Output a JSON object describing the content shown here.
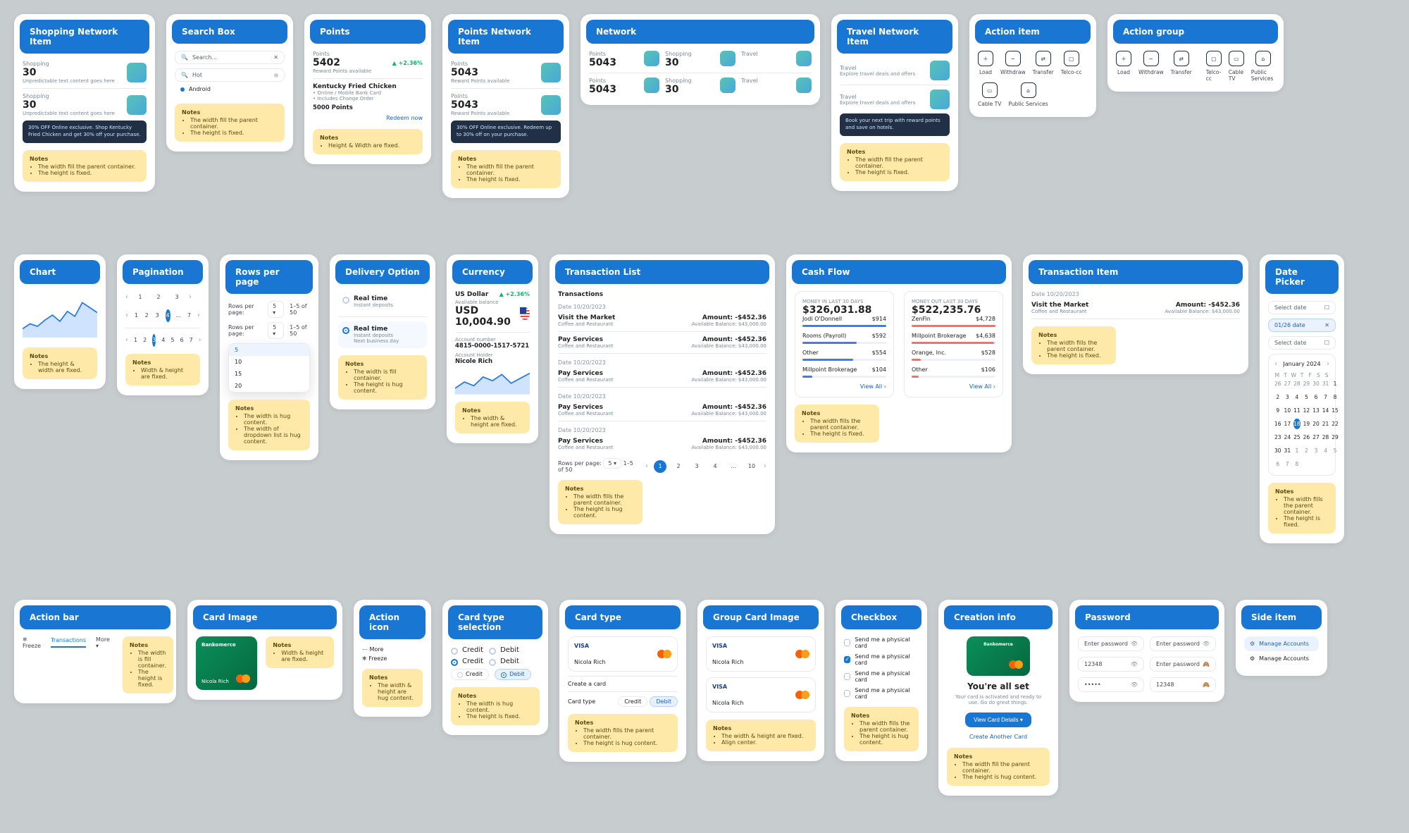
{
  "row1": {
    "shopping_item": {
      "title": "Shopping Network Item",
      "items": [
        {
          "label": "Shopping",
          "value": "30",
          "sub": "Unpredictable text content goes here"
        },
        {
          "label": "Shopping",
          "value": "30",
          "sub": "Unpredictable text content goes here"
        }
      ],
      "footer": "30% OFF Online exclusive. Shop Kentucky Fried Chicken and get 30% off your purchase.",
      "notes": {
        "title": "Notes",
        "items": [
          "The width fill the parent container.",
          "The height is fixed."
        ]
      }
    },
    "search_box": {
      "title": "Search Box",
      "placeholder": "Search...",
      "hot": "Hot",
      "android": "Android",
      "notes": {
        "title": "Notes",
        "items": [
          "The width fill the parent container.",
          "The height is fixed."
        ]
      }
    },
    "points": {
      "title": "Points",
      "label": "Points",
      "value": "5402",
      "trend": "+2.36%",
      "sub": "Reward Points available",
      "merchant": {
        "name": "Kentucky Fried Chicken",
        "tags": [
          "Online / Mobile Bank Card",
          "Includes Change Order"
        ],
        "pts": "5000 Points"
      },
      "redeem": "Redeem now",
      "notes": {
        "title": "Notes",
        "items": [
          "Height & Width are fixed."
        ]
      }
    },
    "points_network": {
      "title": "Points Network Item",
      "items": [
        {
          "label": "Points",
          "value": "5043",
          "sub": "Reward Points available"
        },
        {
          "label": "Points",
          "value": "5043",
          "sub": "Reward Points available"
        }
      ],
      "footer": "30% OFF Online exclusive. Redeem up to 30% off on your purchase.",
      "notes": {
        "title": "Notes",
        "items": [
          "The width fill the parent container.",
          "The height is fixed."
        ]
      }
    },
    "network": {
      "title": "Network",
      "top": [
        {
          "label": "Points",
          "value": "5043"
        },
        {
          "label": "Shopping",
          "value": "30"
        },
        {
          "label": "Travel",
          "value": ""
        }
      ],
      "bottom": [
        {
          "label": "Points",
          "value": "5043"
        },
        {
          "label": "Shopping",
          "value": "30"
        },
        {
          "label": "Travel",
          "value": ""
        }
      ]
    },
    "travel_item": {
      "title": "Travel Network Item",
      "items": [
        {
          "label": "Travel",
          "sub": "Explore travel deals and offers"
        },
        {
          "label": "Travel",
          "sub": "Explore travel deals and offers"
        }
      ],
      "footer": "Book your next trip with reward points and save on hotels.",
      "notes": {
        "title": "Notes",
        "items": [
          "The width fill the parent container.",
          "The height is fixed."
        ]
      }
    },
    "action_item": {
      "title": "Action item",
      "items": [
        "Load",
        "Withdraw",
        "Transfer",
        "Telco-cc",
        "Cable TV",
        "Public Services"
      ]
    },
    "action_group": {
      "title": "Action group",
      "left": [
        "Load",
        "Withdraw",
        "Transfer"
      ],
      "right": [
        "Telco-cc",
        "Cable TV",
        "Public Services"
      ]
    }
  },
  "row2": {
    "chart": {
      "title": "Chart",
      "notes": {
        "title": "Notes",
        "items": [
          "The height & width are fixed."
        ]
      }
    },
    "pagination": {
      "title": "Pagination",
      "pages": [
        "1",
        "2",
        "3",
        "4",
        "5",
        "6",
        "7"
      ],
      "pages2": [
        "1",
        "2",
        "3",
        "4",
        "...",
        "7"
      ],
      "pages3": [
        "1",
        "2",
        "3",
        "4",
        "5",
        "6",
        "7"
      ],
      "notes": {
        "title": "Notes",
        "items": [
          "Width & height are fixed."
        ]
      }
    },
    "rows_per_page": {
      "title": "Rows per page",
      "label": "Rows per page:",
      "value": "5",
      "total": "1–5 of 50",
      "options": [
        "5",
        "10",
        "15",
        "20"
      ],
      "notes": {
        "title": "Notes",
        "items": [
          "The width is hug content.",
          "The width of dropdown list is hug content."
        ]
      }
    },
    "delivery": {
      "title": "Delivery Option",
      "a": {
        "name": "Real time",
        "sub": "Instant deposits"
      },
      "b": {
        "name": "Real time",
        "sub1": "Instant deposits",
        "sub2": "Next business day"
      },
      "notes": {
        "title": "Notes",
        "items": [
          "The width is fill container.",
          "The height is hug content."
        ]
      }
    },
    "currency": {
      "title": "Currency",
      "name": "US Dollar",
      "change": "+2.36%",
      "avail_label": "Available balance",
      "avail": "USD 10,004.90",
      "acct_label": "Account number",
      "acct": "4815-0000-1517-5721",
      "holder_label": "Account Holder",
      "holder": "Nicole Rich",
      "notes": {
        "title": "Notes",
        "items": [
          "The width & height are fixed."
        ]
      }
    },
    "tx_list": {
      "title": "Transaction List",
      "heading": "Transactions",
      "groups": [
        {
          "date": "Date 10/20/2023",
          "rows": [
            {
              "name": "Visit the Market",
              "cat": "Coffee and Restaurant",
              "amount": "Amount: -$452.36",
              "bal": "Available Balance: $43,000.00"
            },
            {
              "name": "Pay Services",
              "cat": "Coffee and Restaurant",
              "amount": "Amount: -$452.36",
              "bal": "Available Balance: $43,000.00"
            }
          ]
        },
        {
          "date": "Date 10/20/2023",
          "rows": [
            {
              "name": "Pay Services",
              "cat": "Coffee and Restaurant",
              "amount": "Amount: -$452.36",
              "bal": "Available Balance: $43,000.00"
            }
          ]
        },
        {
          "date": "Date 10/20/2023",
          "rows": [
            {
              "name": "Pay Services",
              "cat": "Coffee and Restaurant",
              "amount": "Amount: -$452.36",
              "bal": "Available Balance: $43,000.00"
            }
          ]
        },
        {
          "date": "Date 10/20/2023",
          "rows": [
            {
              "name": "Pay Services",
              "cat": "Coffee and Restaurant",
              "amount": "Amount: -$452.36",
              "bal": "Available Balance: $43,000.00"
            }
          ]
        }
      ],
      "footer": {
        "rpp_label": "Rows per page:",
        "rpp": "5",
        "range": "1–5 of 50",
        "pages": [
          "1",
          "2",
          "3",
          "4",
          "...",
          "10"
        ]
      },
      "notes": {
        "title": "Notes",
        "items": [
          "The width fills the parent container.",
          "The height is hug content."
        ]
      }
    },
    "cash_flow": {
      "title": "Cash Flow",
      "in": {
        "label": "MONEY IN LAST 30 DAYS",
        "amount": "$326,031.88",
        "rows": [
          {
            "name": "Jodi O'Donnell",
            "val": "$914"
          },
          {
            "name": "Rooms (Payroll)",
            "val": "$592"
          },
          {
            "name": "Other",
            "val": "$554"
          },
          {
            "name": "Millpoint Brokerage",
            "val": "$104"
          }
        ],
        "view": "View All"
      },
      "out": {
        "label": "MONEY OUT LAST 30 DAYS",
        "amount": "$522,235.76",
        "rows": [
          {
            "name": "ZenFin",
            "val": "$4,728"
          },
          {
            "name": "Millpoint Brokerage",
            "val": "$4,638"
          },
          {
            "name": "Orange, Inc.",
            "val": "$528"
          },
          {
            "name": "Other",
            "val": "$106"
          }
        ],
        "view": "View All"
      },
      "notes": {
        "title": "Notes",
        "items": [
          "The width fills the parent container.",
          "The height is fixed."
        ]
      }
    },
    "tx_item": {
      "title": "Transaction Item",
      "date": "Date 10/20/2023",
      "name": "Visit the Market",
      "cat": "Coffee and Restaurant",
      "amount": "Amount: -$452.36",
      "bal": "Available Balance: $43,000.00",
      "notes": {
        "title": "Notes",
        "items": [
          "The width fills the parent container.",
          "The height is fixed."
        ]
      }
    },
    "date_picker": {
      "title": "Date Picker",
      "a": "Select date",
      "b": "01/26 date",
      "c": "Select date",
      "month": "January 2024",
      "wk": [
        "M",
        "T",
        "W",
        "T",
        "F",
        "S",
        "S"
      ],
      "prev_tail": [
        "26",
        "27",
        "28",
        "29",
        "30",
        "31"
      ],
      "days": [
        "1",
        "2",
        "3",
        "4",
        "5",
        "6",
        "7",
        "8",
        "9",
        "10",
        "11",
        "12",
        "13",
        "14",
        "15",
        "16",
        "17",
        "18",
        "19",
        "20",
        "21",
        "22",
        "23",
        "24",
        "25",
        "26",
        "27",
        "28",
        "29",
        "30",
        "31"
      ],
      "next_head": [
        "1",
        "2",
        "3",
        "4",
        "5",
        "6",
        "7",
        "8"
      ],
      "selected": "18",
      "notes": {
        "title": "Notes",
        "items": [
          "The width fills the parent container.",
          "The height is fixed."
        ]
      }
    }
  },
  "row3": {
    "action_bar": {
      "title": "Action bar",
      "items": [
        "Freeze",
        "Transactions",
        "More"
      ],
      "notes": {
        "title": "Notes",
        "items": [
          "The width is fill container.",
          "The height is fixed."
        ]
      }
    },
    "card_image": {
      "title": "Card Image",
      "brand": "Bankomerce",
      "holder": "Nicola Rich",
      "notes": {
        "title": "Notes",
        "items": [
          "Width & height are fixed."
        ]
      }
    },
    "action_icon": {
      "title": "Action icon",
      "items": [
        "More",
        "Freeze"
      ],
      "notes": {
        "title": "Notes",
        "items": [
          "The width & height are hug content."
        ]
      }
    },
    "card_type_sel": {
      "title": "Card type selection",
      "opts": [
        "Credit",
        "Debit",
        "Credit",
        "Debit",
        "Credit",
        "Debit"
      ],
      "notes": {
        "title": "Notes",
        "items": [
          "The width is hug content.",
          "The height is fixed."
        ]
      }
    },
    "card_type": {
      "title": "Card type",
      "brand": "VISA",
      "holder": "Nicola Rich",
      "create": "Create a card",
      "ct_label": "Card type",
      "opts": [
        "Credit",
        "Debit"
      ],
      "notes": {
        "title": "Notes",
        "items": [
          "The width fills the parent container.",
          "The height is hug content."
        ]
      }
    },
    "group_card_image": {
      "title": "Group Card Image",
      "brand": "VISA",
      "holder": "Nicola Rich",
      "notes": {
        "title": "Notes",
        "items": [
          "The width & height are fixed.",
          "Align center."
        ]
      }
    },
    "checkbox": {
      "title": "Checkbox",
      "a": "Send me a physical card",
      "b": "Send me a physical card",
      "c": "Send me a physical card",
      "d": "Send me a physical card",
      "notes": {
        "title": "Notes",
        "items": [
          "The width fills the parent container.",
          "The height is hug content."
        ]
      }
    },
    "creation": {
      "title": "Creation info",
      "brand": "Bankomerce",
      "heading": "You're all set",
      "sub": "Your card is activated and ready to use. Go do great things.",
      "cta": "View Card Details",
      "link": "Create Another Card",
      "notes": {
        "title": "Notes",
        "items": [
          "The width fill the parent container.",
          "The height is hug content."
        ]
      }
    },
    "password": {
      "title": "Password",
      "labels": [
        "Enter password",
        "Enter password",
        "12348",
        "Enter password",
        "12348"
      ],
      "icons": [
        "eye",
        "eye",
        "eye",
        "eye-off",
        "eye-off"
      ]
    },
    "side_item": {
      "title": "Side item",
      "a": "Manage Accounts",
      "b": "Manage Accounts"
    }
  },
  "chart_data": {
    "type": "area",
    "x": [
      0,
      1,
      2,
      3,
      4,
      5,
      6,
      7,
      8,
      9
    ],
    "values": [
      14,
      20,
      16,
      24,
      30,
      22,
      34,
      28,
      44,
      38
    ],
    "ylim": [
      0,
      50
    ],
    "title": "",
    "xlabel": "",
    "ylabel": ""
  }
}
